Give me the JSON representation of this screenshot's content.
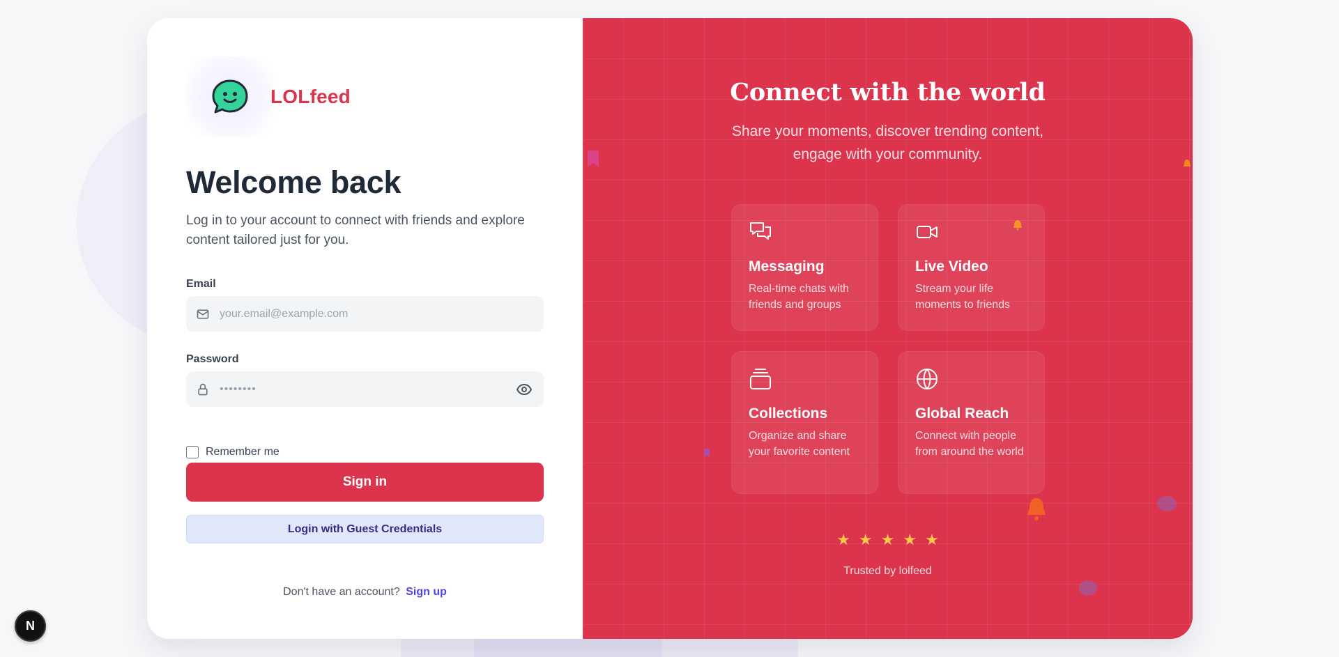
{
  "brand": {
    "name": "LOLfeed"
  },
  "login": {
    "title": "Welcome back",
    "subtitle": "Log in to your account to connect with friends and explore content tailored just for you.",
    "email_label": "Email",
    "email_placeholder": "your.email@example.com",
    "password_label": "Password",
    "password_placeholder": "••••••••",
    "remember_label": "Remember me",
    "sign_in_label": "Sign in",
    "guest_label": "Login with Guest Credentials",
    "no_account_text": "Don't have an account?",
    "sign_up_label": "Sign up"
  },
  "hero": {
    "title": "Connect with the world",
    "subtitle": "Share your moments, discover trending content, engage with your community.",
    "features": [
      {
        "icon": "chat-bubbles-icon",
        "title": "Messaging",
        "desc": "Real-time chats with friends and groups"
      },
      {
        "icon": "video-camera-icon",
        "title": "Live Video",
        "desc": "Stream your life moments to friends"
      },
      {
        "icon": "collections-stack-icon",
        "title": "Collections",
        "desc": "Organize and share your favorite content"
      },
      {
        "icon": "globe-icon",
        "title": "Global Reach",
        "desc": "Connect with people from around the world"
      }
    ],
    "rating": 5,
    "stars": "★★★★★",
    "trusted_text": "Trusted by lolfeed"
  },
  "dev_badge": {
    "label": "N"
  },
  "colors": {
    "accent": "#dc344c",
    "guest_button_bg": "#e0e7fb",
    "link": "#4f46e5",
    "star": "#f9c74f"
  }
}
